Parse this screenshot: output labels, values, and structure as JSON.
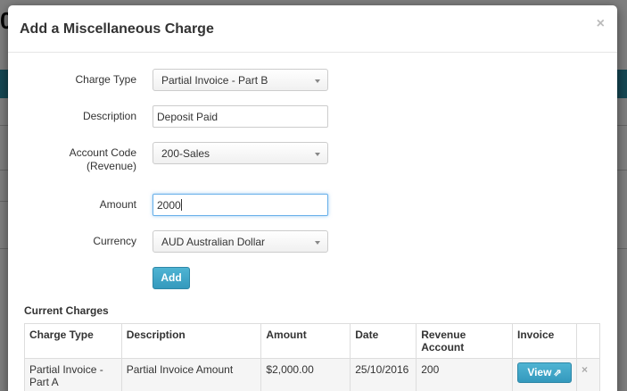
{
  "background": {
    "zero_text": "0"
  },
  "modal": {
    "title": "Add a Miscellaneous Charge",
    "close_glyph": "×"
  },
  "form": {
    "charge_type": {
      "label": "Charge Type",
      "value": "Partial Invoice - Part B"
    },
    "description": {
      "label": "Description",
      "value": "Deposit Paid"
    },
    "account_code": {
      "label_line1": "Account Code",
      "label_line2": "(Revenue)",
      "value": "200-Sales"
    },
    "amount": {
      "label": "Amount",
      "value": "2000"
    },
    "currency": {
      "label": "Currency",
      "value": "AUD Australian Dollar"
    },
    "add_label": "Add"
  },
  "current_charges": {
    "title": "Current Charges",
    "columns": [
      "Charge Type",
      "Description",
      "Amount",
      "Date",
      "Revenue Account",
      "Invoice",
      ""
    ],
    "rows": [
      {
        "charge_type": "Partial Invoice - Part A",
        "description": "Partial Invoice Amount",
        "amount": "$2,000.00",
        "date": "25/10/2016",
        "revenue_account": "200",
        "view_label": "View",
        "remove_glyph": "×"
      }
    ]
  },
  "icons": {
    "external_link": "external-link-icon",
    "close": "close-icon",
    "caret": "caret-down-icon"
  },
  "colors": {
    "accent": "#3aa3c6",
    "focus_border": "#66afe9"
  }
}
